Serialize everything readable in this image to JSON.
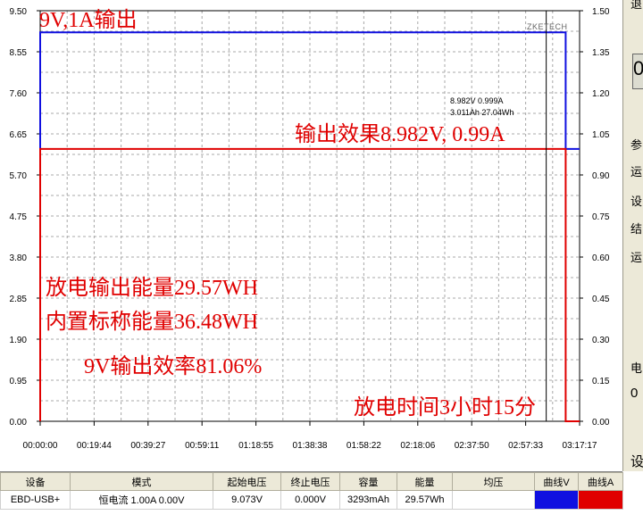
{
  "chart_data": {
    "type": "line",
    "x_tick_labels": [
      "00:00:00",
      "00:19:44",
      "00:39:27",
      "00:59:11",
      "01:18:55",
      "01:38:38",
      "01:58:22",
      "02:18:06",
      "02:37:50",
      "02:57:33",
      "03:17:17"
    ],
    "y_left_ticks": [
      "0.00",
      "0.95",
      "1.90",
      "2.85",
      "3.80",
      "4.75",
      "5.70",
      "6.65",
      "7.60",
      "8.55",
      "9.50"
    ],
    "y_right_ticks": [
      "0.00",
      "0.15",
      "0.30",
      "0.45",
      "0.60",
      "0.75",
      "0.90",
      "1.05",
      "1.20",
      "1.35",
      "1.50"
    ],
    "ylim_left": [
      0,
      9.5
    ],
    "ylim_right": [
      0,
      1.5
    ],
    "xlim_seconds": [
      0,
      11837
    ],
    "grid": true,
    "series": [
      {
        "axis": "left",
        "color": "#1010e0",
        "points": [
          [
            0,
            0
          ],
          [
            0,
            9.0
          ],
          [
            11532,
            9.0
          ],
          [
            11532,
            6.3
          ],
          [
            11837,
            6.3
          ]
        ]
      },
      {
        "axis": "right",
        "color": "#e00000",
        "points": [
          [
            0,
            0
          ],
          [
            0,
            0.995
          ],
          [
            11532,
            0.995
          ],
          [
            11532,
            0
          ],
          [
            11837,
            0
          ]
        ]
      }
    ],
    "cursor_x": 11105,
    "cursor_readout": [
      "8.982V  0.999A",
      "3.011Ah 27.04Wh"
    ],
    "watermark": "ZKETECH",
    "annotations": {
      "title": "9V,1A输出",
      "output_effect": "输出效果8.982V, 0.99A",
      "discharge_energy": "放电输出能量29.57WH",
      "rated_energy": "内置标称能量36.48WH",
      "efficiency": "9V输出效率81.06%",
      "discharge_time": "放电时间3小时15分"
    }
  },
  "right_panel": {
    "chars": [
      "退",
      "0",
      "参",
      "运",
      "设",
      "结",
      "运",
      "电",
      "0",
      "设"
    ]
  },
  "table": {
    "headers": [
      "设备",
      "模式",
      "起始电压",
      "终止电压",
      "容量",
      "能量",
      "均压",
      "曲线V",
      "曲线A"
    ],
    "row": {
      "device": "EBD-USB+",
      "mode": "恒电流  1.00A  0.00V",
      "start_voltage": "9.073V",
      "end_voltage": "0.000V",
      "capacity": "3293mAh",
      "energy": "29.57Wh",
      "avg_voltage": ""
    },
    "curve_v_color": "#1010e0",
    "curve_a_color": "#e00000"
  }
}
